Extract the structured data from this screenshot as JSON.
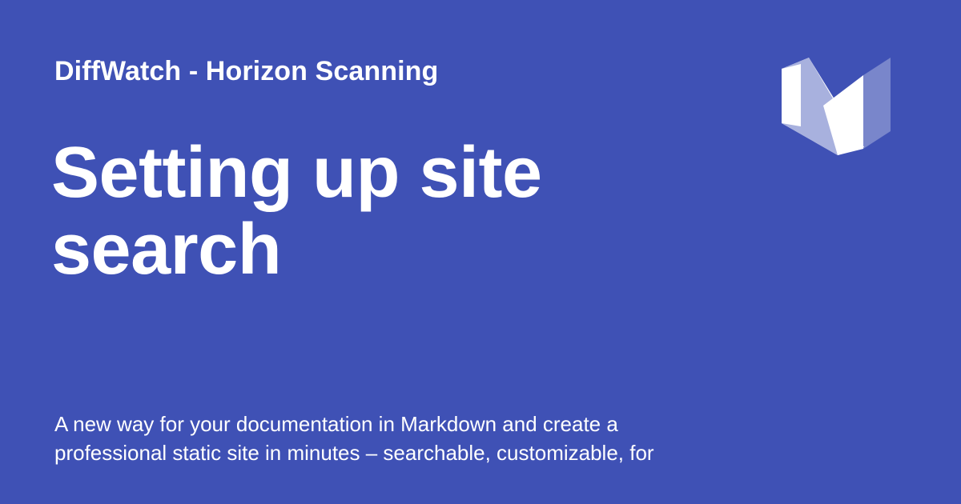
{
  "card": {
    "site_name": "DiffWatch - Horizon Scanning",
    "title_lines": [
      "Setting up site",
      "search"
    ],
    "description_lines": [
      "A new way for your documentation in Markdown and create a",
      "professional static site in minutes – searchable, customizable, for"
    ],
    "logo_icon": "material-logo-icon",
    "colors": {
      "background": "#3f51b5",
      "text": "#ffffff",
      "logo_front": "#ffffff",
      "logo_mid": "#9fa8da",
      "logo_back": "#7986cb"
    }
  }
}
